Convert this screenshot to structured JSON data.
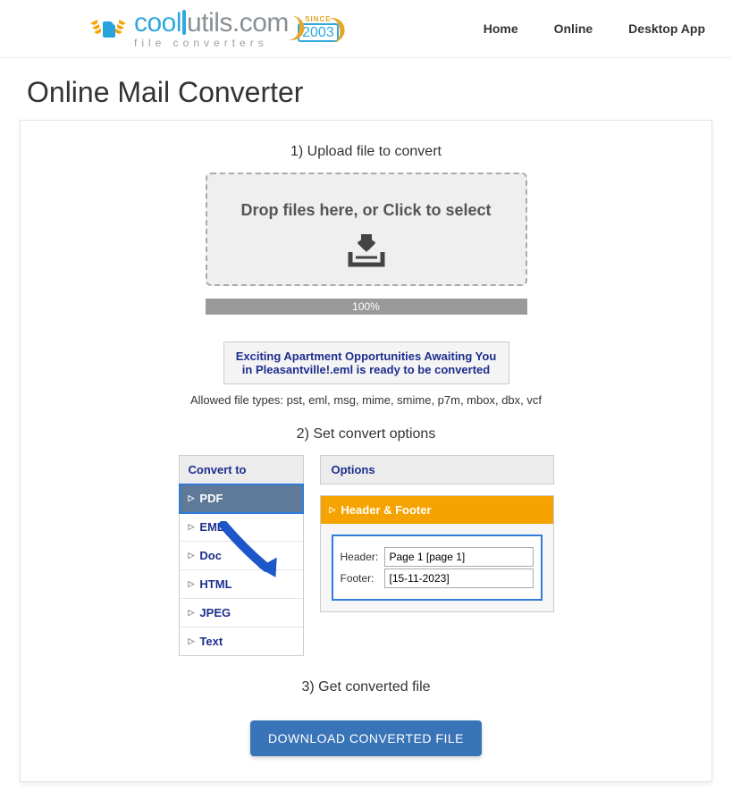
{
  "header": {
    "brand_cool": "cool",
    "brand_utils": "utils",
    "brand_dotcom": ".com",
    "brand_sub": "file converters",
    "since_label": "SINCE",
    "since_year": "2003",
    "nav": {
      "home": "Home",
      "online": "Online",
      "desktop": "Desktop App"
    }
  },
  "page_title": "Online Mail Converter",
  "step1": {
    "heading": "1) Upload file to convert",
    "drop_text": "Drop files here, or Click to select",
    "progress_pct": "100%",
    "ready_msg": "Exciting Apartment Opportunities Awaiting You in Pleasantville!.eml is ready to be converted",
    "allowed": "Allowed file types: pst, eml, msg, mime, smime, p7m, mbox, dbx, vcf"
  },
  "step2": {
    "heading": "2) Set convert options",
    "list_head": "Convert to",
    "formats": {
      "pdf": "PDF",
      "eml": "EML",
      "doc": "Doc",
      "html": "HTML",
      "jpeg": "JPEG",
      "text": "Text"
    },
    "options_head": "Options",
    "hf_head": "Header & Footer",
    "header_label": "Header:",
    "footer_label": "Footer:",
    "header_value": "Page 1 [page 1]",
    "footer_value": "[15-11-2023]"
  },
  "step3": {
    "heading": "3) Get converted file",
    "button": "DOWNLOAD CONVERTED FILE"
  }
}
